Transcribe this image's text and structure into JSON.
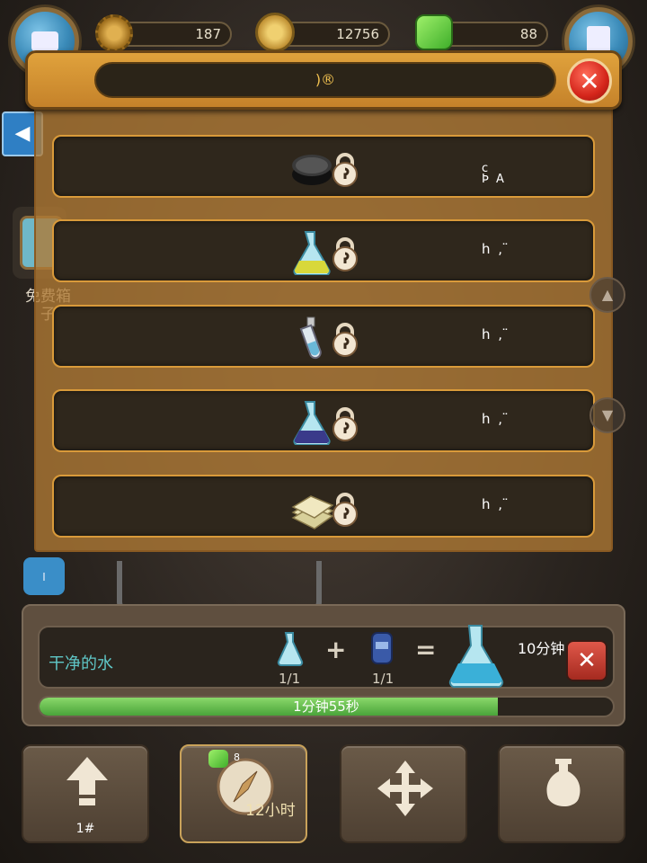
{
  "top_bar": {
    "gears_count": "187",
    "gold_count": "12756",
    "gems_count": "88"
  },
  "side": {
    "free_box_label_line1": "免费箱",
    "free_box_label_line2": "子"
  },
  "modal": {
    "title": ")®",
    "rows": [
      {
        "item_icon": "rubber-block-icon",
        "text": "c\nÞ A"
      },
      {
        "item_icon": "yellow-flask-icon",
        "text": "h ,  ̈"
      },
      {
        "item_icon": "bottle-icon",
        "text": "h ,  ̈"
      },
      {
        "item_icon": "blue-flask-icon",
        "text": "h ,  ̈"
      },
      {
        "item_icon": "paper-stack-icon",
        "text": "h ,  ̈"
      }
    ]
  },
  "production": {
    "recipe_name": "干净的水",
    "ingredient1_count": "1/1",
    "ingredient2_count": "1/1",
    "plus_symbol": "+",
    "equals_symbol": "=",
    "time_label": "10分钟",
    "progress_text": "1分钟55秒",
    "progress": 0.8
  },
  "bottom_buttons": {
    "upgrade_label": "1#",
    "speedup_label": "12小时",
    "speedup_gem_cost": "8"
  },
  "colors": {
    "accent_orange": "#d99a3a",
    "progress_green": "#4aa43a",
    "recipe_teal": "#5fc7c7",
    "close_red": "#d4251a"
  }
}
